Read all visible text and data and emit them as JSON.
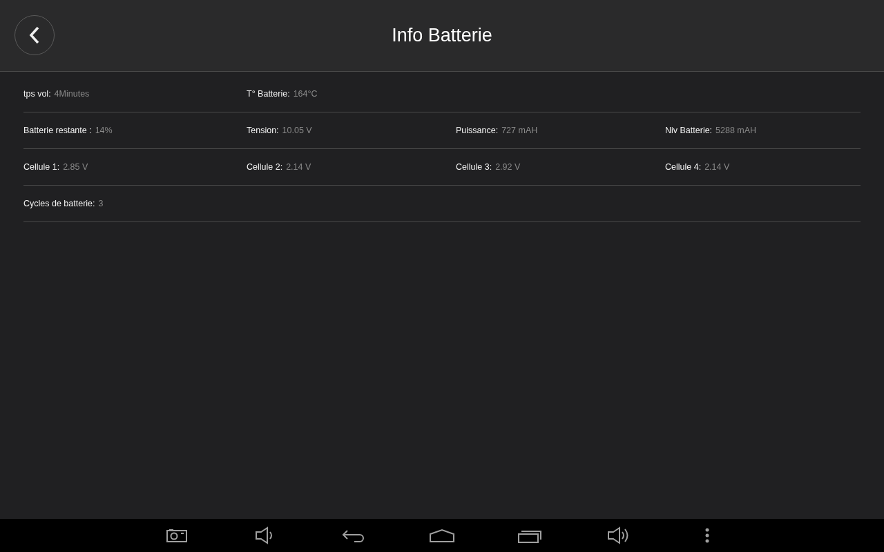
{
  "header": {
    "title": "Info Batterie"
  },
  "rows": [
    [
      {
        "label": "tps vol:",
        "value": "4Minutes"
      },
      {
        "label": "T° Batterie:",
        "value": "164°C"
      }
    ],
    [
      {
        "label": "Batterie restante :",
        "value": "14%"
      },
      {
        "label": "Tension:",
        "value": "10.05 V"
      },
      {
        "label": "Puissance:",
        "value": "727 mAH"
      },
      {
        "label": "Niv Batterie:",
        "value": "5288 mAH"
      }
    ],
    [
      {
        "label": "Cellule 1:",
        "value": "2.85 V"
      },
      {
        "label": "Cellule 2:",
        "value": "2.14 V"
      },
      {
        "label": "Cellule 3:",
        "value": "2.92 V"
      },
      {
        "label": "Cellule 4:",
        "value": "2.14 V"
      }
    ],
    [
      {
        "label": "Cycles de batterie:",
        "value": "3"
      }
    ]
  ],
  "nav_bar": [
    {
      "kind": "camera"
    },
    {
      "kind": "volume-down"
    },
    {
      "kind": "back"
    },
    {
      "kind": "home"
    },
    {
      "kind": "recents"
    },
    {
      "kind": "volume-up"
    },
    {
      "kind": "menu"
    }
  ]
}
